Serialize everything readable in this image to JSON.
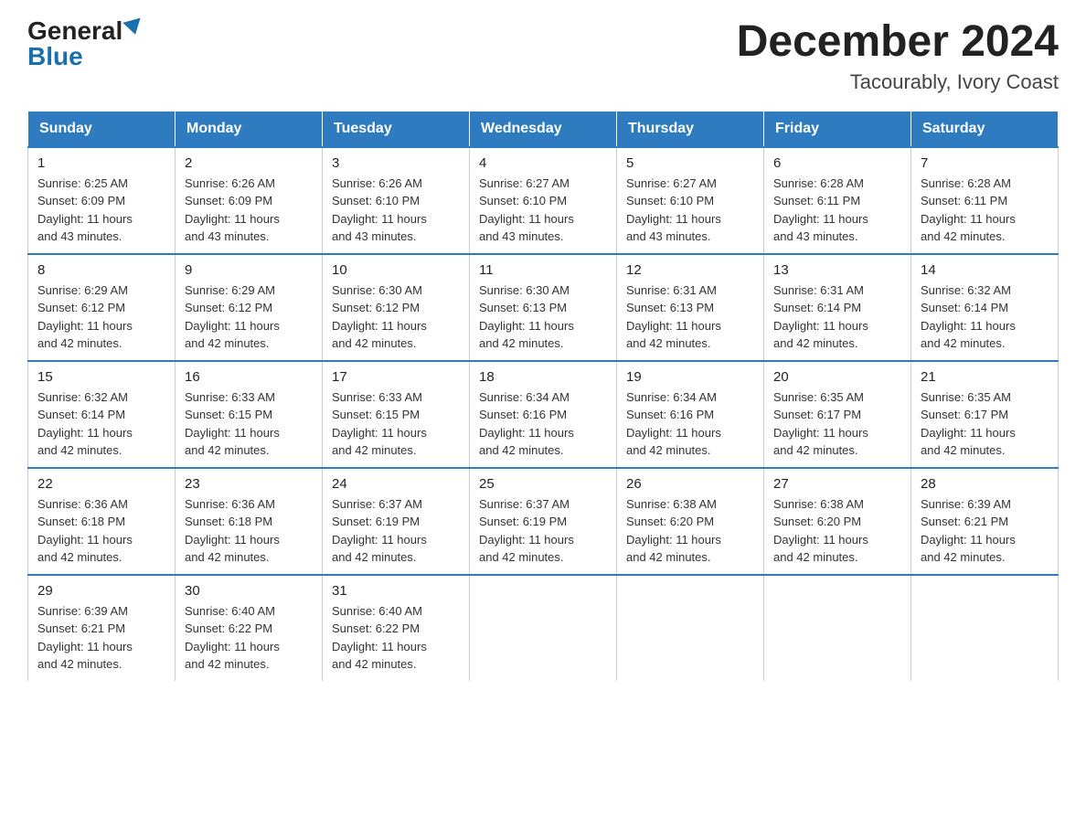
{
  "logo": {
    "general": "General",
    "blue": "Blue"
  },
  "title": "December 2024",
  "subtitle": "Tacourably, Ivory Coast",
  "days_of_week": [
    "Sunday",
    "Monday",
    "Tuesday",
    "Wednesday",
    "Thursday",
    "Friday",
    "Saturday"
  ],
  "weeks": [
    [
      {
        "day": "1",
        "sunrise": "6:25 AM",
        "sunset": "6:09 PM",
        "daylight": "11 hours and 43 minutes."
      },
      {
        "day": "2",
        "sunrise": "6:26 AM",
        "sunset": "6:09 PM",
        "daylight": "11 hours and 43 minutes."
      },
      {
        "day": "3",
        "sunrise": "6:26 AM",
        "sunset": "6:10 PM",
        "daylight": "11 hours and 43 minutes."
      },
      {
        "day": "4",
        "sunrise": "6:27 AM",
        "sunset": "6:10 PM",
        "daylight": "11 hours and 43 minutes."
      },
      {
        "day": "5",
        "sunrise": "6:27 AM",
        "sunset": "6:10 PM",
        "daylight": "11 hours and 43 minutes."
      },
      {
        "day": "6",
        "sunrise": "6:28 AM",
        "sunset": "6:11 PM",
        "daylight": "11 hours and 43 minutes."
      },
      {
        "day": "7",
        "sunrise": "6:28 AM",
        "sunset": "6:11 PM",
        "daylight": "11 hours and 42 minutes."
      }
    ],
    [
      {
        "day": "8",
        "sunrise": "6:29 AM",
        "sunset": "6:12 PM",
        "daylight": "11 hours and 42 minutes."
      },
      {
        "day": "9",
        "sunrise": "6:29 AM",
        "sunset": "6:12 PM",
        "daylight": "11 hours and 42 minutes."
      },
      {
        "day": "10",
        "sunrise": "6:30 AM",
        "sunset": "6:12 PM",
        "daylight": "11 hours and 42 minutes."
      },
      {
        "day": "11",
        "sunrise": "6:30 AM",
        "sunset": "6:13 PM",
        "daylight": "11 hours and 42 minutes."
      },
      {
        "day": "12",
        "sunrise": "6:31 AM",
        "sunset": "6:13 PM",
        "daylight": "11 hours and 42 minutes."
      },
      {
        "day": "13",
        "sunrise": "6:31 AM",
        "sunset": "6:14 PM",
        "daylight": "11 hours and 42 minutes."
      },
      {
        "day": "14",
        "sunrise": "6:32 AM",
        "sunset": "6:14 PM",
        "daylight": "11 hours and 42 minutes."
      }
    ],
    [
      {
        "day": "15",
        "sunrise": "6:32 AM",
        "sunset": "6:14 PM",
        "daylight": "11 hours and 42 minutes."
      },
      {
        "day": "16",
        "sunrise": "6:33 AM",
        "sunset": "6:15 PM",
        "daylight": "11 hours and 42 minutes."
      },
      {
        "day": "17",
        "sunrise": "6:33 AM",
        "sunset": "6:15 PM",
        "daylight": "11 hours and 42 minutes."
      },
      {
        "day": "18",
        "sunrise": "6:34 AM",
        "sunset": "6:16 PM",
        "daylight": "11 hours and 42 minutes."
      },
      {
        "day": "19",
        "sunrise": "6:34 AM",
        "sunset": "6:16 PM",
        "daylight": "11 hours and 42 minutes."
      },
      {
        "day": "20",
        "sunrise": "6:35 AM",
        "sunset": "6:17 PM",
        "daylight": "11 hours and 42 minutes."
      },
      {
        "day": "21",
        "sunrise": "6:35 AM",
        "sunset": "6:17 PM",
        "daylight": "11 hours and 42 minutes."
      }
    ],
    [
      {
        "day": "22",
        "sunrise": "6:36 AM",
        "sunset": "6:18 PM",
        "daylight": "11 hours and 42 minutes."
      },
      {
        "day": "23",
        "sunrise": "6:36 AM",
        "sunset": "6:18 PM",
        "daylight": "11 hours and 42 minutes."
      },
      {
        "day": "24",
        "sunrise": "6:37 AM",
        "sunset": "6:19 PM",
        "daylight": "11 hours and 42 minutes."
      },
      {
        "day": "25",
        "sunrise": "6:37 AM",
        "sunset": "6:19 PM",
        "daylight": "11 hours and 42 minutes."
      },
      {
        "day": "26",
        "sunrise": "6:38 AM",
        "sunset": "6:20 PM",
        "daylight": "11 hours and 42 minutes."
      },
      {
        "day": "27",
        "sunrise": "6:38 AM",
        "sunset": "6:20 PM",
        "daylight": "11 hours and 42 minutes."
      },
      {
        "day": "28",
        "sunrise": "6:39 AM",
        "sunset": "6:21 PM",
        "daylight": "11 hours and 42 minutes."
      }
    ],
    [
      {
        "day": "29",
        "sunrise": "6:39 AM",
        "sunset": "6:21 PM",
        "daylight": "11 hours and 42 minutes."
      },
      {
        "day": "30",
        "sunrise": "6:40 AM",
        "sunset": "6:22 PM",
        "daylight": "11 hours and 42 minutes."
      },
      {
        "day": "31",
        "sunrise": "6:40 AM",
        "sunset": "6:22 PM",
        "daylight": "11 hours and 42 minutes."
      },
      null,
      null,
      null,
      null
    ]
  ],
  "labels": {
    "sunrise": "Sunrise:",
    "sunset": "Sunset:",
    "daylight": "Daylight:"
  }
}
